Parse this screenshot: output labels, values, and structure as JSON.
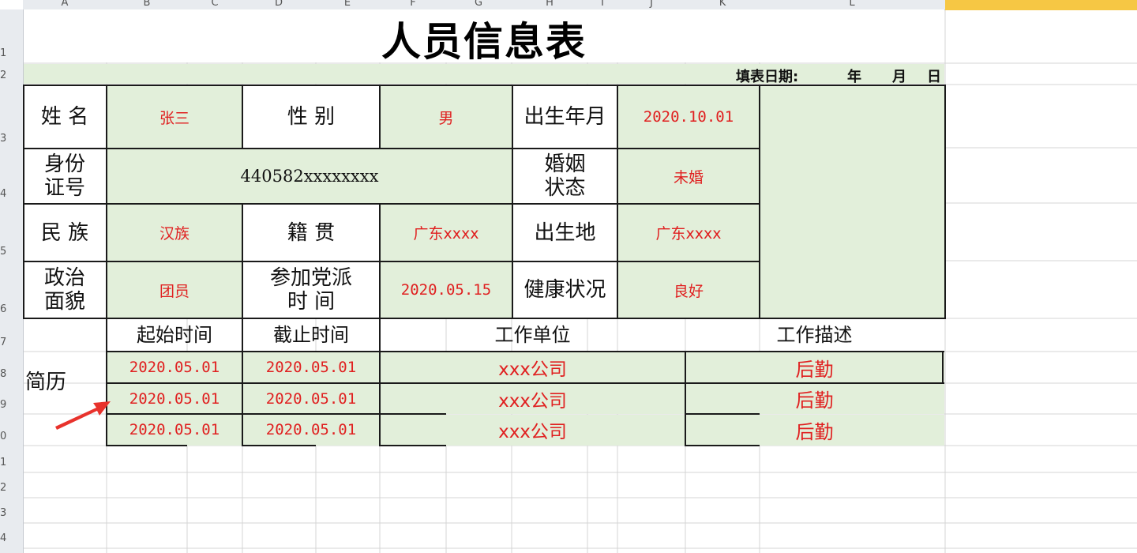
{
  "sheet": {
    "columns": [
      "A",
      "B",
      "C",
      "D",
      "E",
      "F",
      "G",
      "H",
      "I",
      "J",
      "K",
      "L"
    ],
    "rows": [
      "1",
      "2",
      "3",
      "4",
      "5",
      "6",
      "7",
      "8",
      "9",
      "0",
      "1",
      "2",
      "3",
      "4"
    ]
  },
  "form": {
    "title": "人员信息表",
    "fill_date_label": "填表日期:",
    "fill_date_year": "年",
    "fill_date_month": "月",
    "fill_date_day": "日",
    "name_label": "姓 名",
    "name_value": "张三",
    "gender_label": "性 别",
    "gender_value": "男",
    "birth_label": "出生年月",
    "birth_value": "2020.10.01",
    "id_label_1": "身份",
    "id_label_2": "证号",
    "id_value": "440582xxxxxxxx",
    "marital_label_1": "婚姻",
    "marital_label_2": "状态",
    "marital_value": "未婚",
    "ethnic_label": "民 族",
    "ethnic_value": "汉族",
    "native_label": "籍 贯",
    "native_value": "广东xxxx",
    "birthplace_label": "出生地",
    "birthplace_value": "广东xxxx",
    "political_label_1": "政治",
    "political_label_2": "面貌",
    "political_value": "团员",
    "party_label_1": "参加党派",
    "party_label_2": "时 间",
    "party_value": "2020.05.15",
    "health_label": "健康状况",
    "health_value": "良好",
    "resume_label": "简历",
    "resume_headers": [
      "起始时间",
      "截止时间",
      "工作单位",
      "工作描述"
    ],
    "resume_rows": [
      {
        "start": "2020.05.01",
        "end": "2020.05.01",
        "unit": "xxx公司",
        "desc": "后勤"
      },
      {
        "start": "2020.05.01",
        "end": "2020.05.01",
        "unit": "xxx公司",
        "desc": "后勤"
      },
      {
        "start": "2020.05.01",
        "end": "2020.05.01",
        "unit": "xxx公司",
        "desc": "后勤"
      }
    ]
  },
  "colors": {
    "fill_green": "#e2efda",
    "value_red": "#e02020",
    "arrow_red": "#e8322c",
    "selected_tab": "#f6c744"
  }
}
